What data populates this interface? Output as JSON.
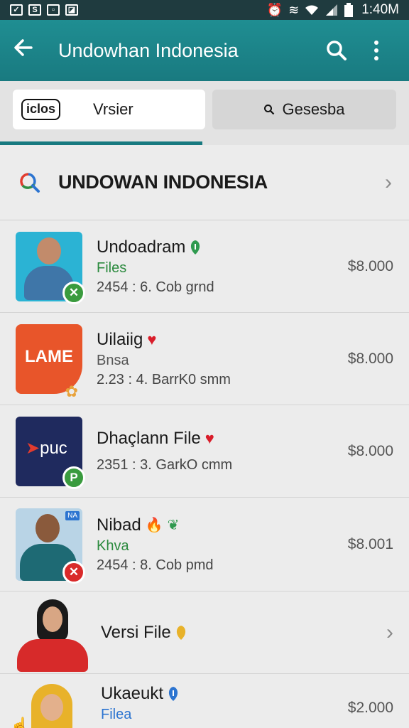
{
  "status_bar": {
    "time": "1:40M"
  },
  "app_bar": {
    "title": "Undowhan Indonesia"
  },
  "tabs": [
    {
      "logo": "iclos",
      "label": "Vrsier"
    },
    {
      "label": "Gesesba"
    }
  ],
  "section_header": {
    "label": "UNDOWAN INDONESIA"
  },
  "items": [
    {
      "name": "Undoadram",
      "sub": "Files",
      "meta": "2454 : 6. Cob grnd",
      "price": "$8.000"
    },
    {
      "thumb_text": "LAME",
      "name": "Uilaiig",
      "sub": "Bnsa",
      "meta": "2.23 : 4. BarrK0 smm",
      "price": "$8.000"
    },
    {
      "thumb_text": "puc",
      "badge": "P",
      "name": "Dhaçlann File",
      "meta": "2351 : 3. GarkO cmm",
      "price": "$8.000"
    },
    {
      "thumb_tag": "NA",
      "name": "Nibad",
      "sub": "Khva",
      "meta": "2454 : 8. Cob pmd",
      "price": "$8.001"
    },
    {
      "name": "Versi File"
    },
    {
      "name": "Ukaeukt",
      "sub": "Filea",
      "price": "$2.000"
    }
  ],
  "colors": {
    "app_bar": "#1f8e92",
    "accent_green": "#2b8a3e",
    "heart": "#d91d2a"
  }
}
